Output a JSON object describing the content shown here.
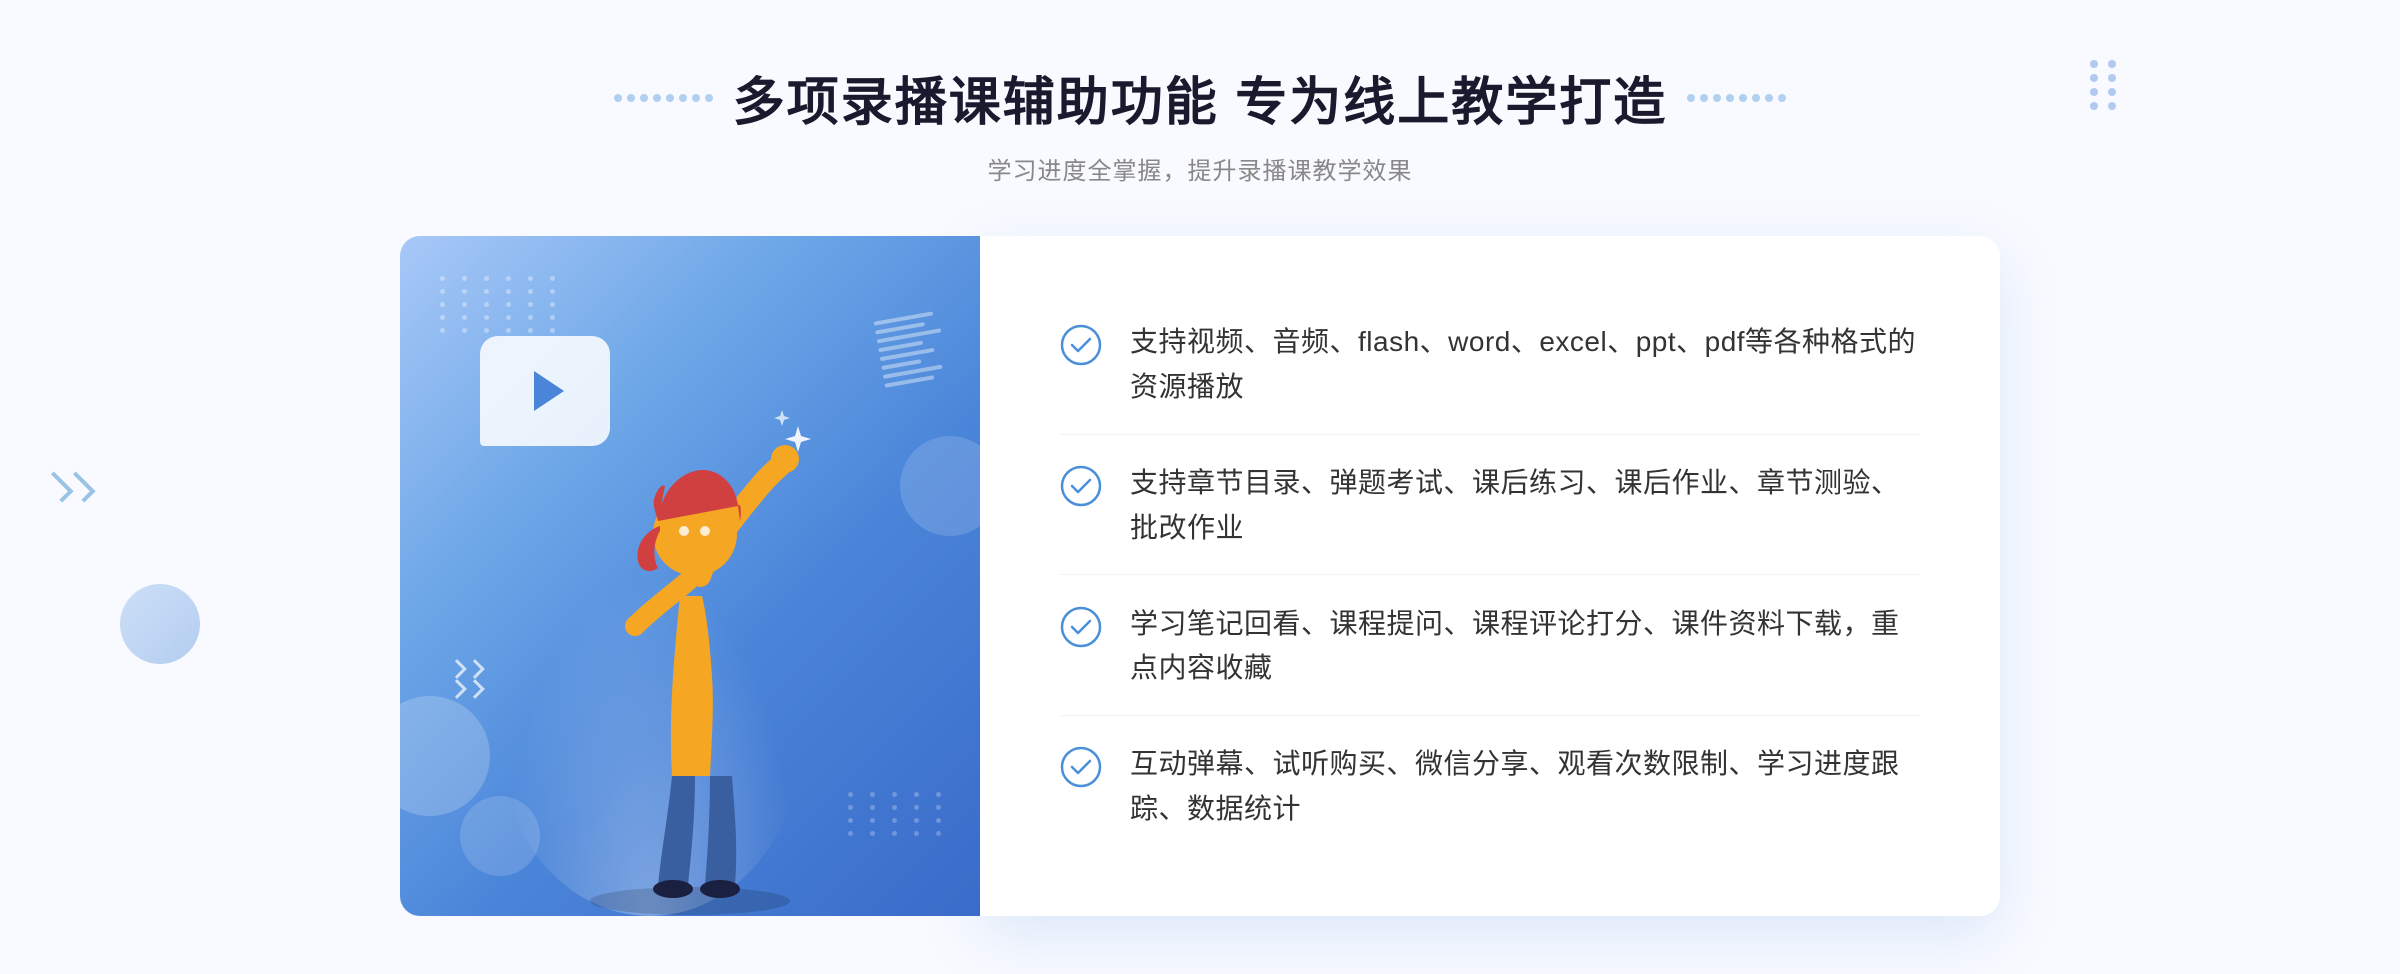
{
  "header": {
    "title": "多项录播课辅助功能 专为线上教学打造",
    "subtitle": "学习进度全掌握，提升录播课教学效果",
    "dots_decoration": true
  },
  "features": [
    {
      "id": 1,
      "text": "支持视频、音频、flash、word、excel、ppt、pdf等各种格式的资源播放"
    },
    {
      "id": 2,
      "text": "支持章节目录、弹题考试、课后练习、课后作业、章节测验、批改作业"
    },
    {
      "id": 3,
      "text": "学习笔记回看、课程提问、课程评论打分、课件资料下载，重点内容收藏"
    },
    {
      "id": 4,
      "text": "互动弹幕、试听购买、微信分享、观看次数限制、学习进度跟踪、数据统计"
    }
  ],
  "colors": {
    "primary_blue": "#4a85d9",
    "light_blue": "#a8c8f8",
    "check_color": "#4a90d9",
    "text_dark": "#333333",
    "text_gray": "#888888",
    "bg_light": "#f8faff"
  },
  "left_arrow_symbol": "»"
}
